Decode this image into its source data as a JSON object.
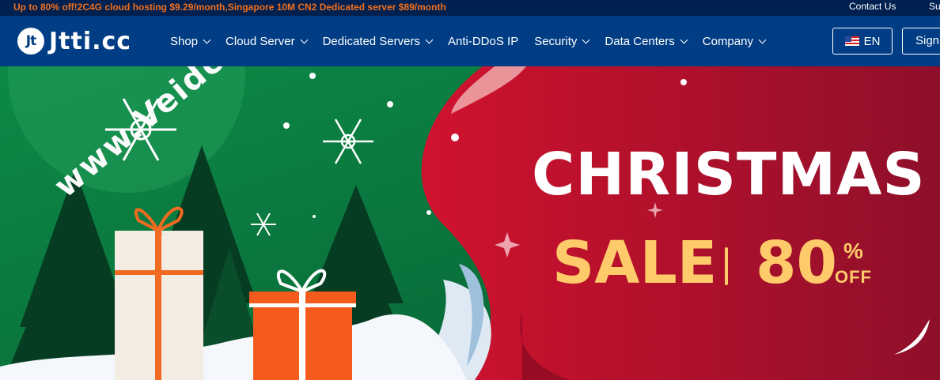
{
  "topbar": {
    "promo": "Up to 80% off!2C4G cloud hosting $9.29/month,Singapore 10M CN2 Dedicated server $89/month",
    "contact": "Contact Us",
    "support": "Su"
  },
  "navbar": {
    "logo_mark": "Jt",
    "logo_text": "Jtti.cc",
    "menu": [
      {
        "label": "Shop",
        "has_dropdown": true
      },
      {
        "label": "Cloud Server",
        "has_dropdown": true
      },
      {
        "label": "Dedicated Servers",
        "has_dropdown": true
      },
      {
        "label": "Anti-DDoS IP",
        "has_dropdown": false
      },
      {
        "label": "Security",
        "has_dropdown": true
      },
      {
        "label": "Data Centers",
        "has_dropdown": true
      },
      {
        "label": "Company",
        "has_dropdown": true
      }
    ],
    "language": "EN",
    "sign": "Sign"
  },
  "banner": {
    "headline": "CHRISTMAS",
    "sale": "SALE",
    "percent_value": "80",
    "percent_sign": "%",
    "off": "OFF",
    "watermark": "www.Veidc.com"
  },
  "colors": {
    "topbar_bg": "#002050",
    "promo_text": "#f26f1c",
    "navbar_bg": "#003d84",
    "banner_green": "#0c7a3e",
    "banner_red": "#c8102e",
    "sale_gold": "#ffcb6a"
  }
}
